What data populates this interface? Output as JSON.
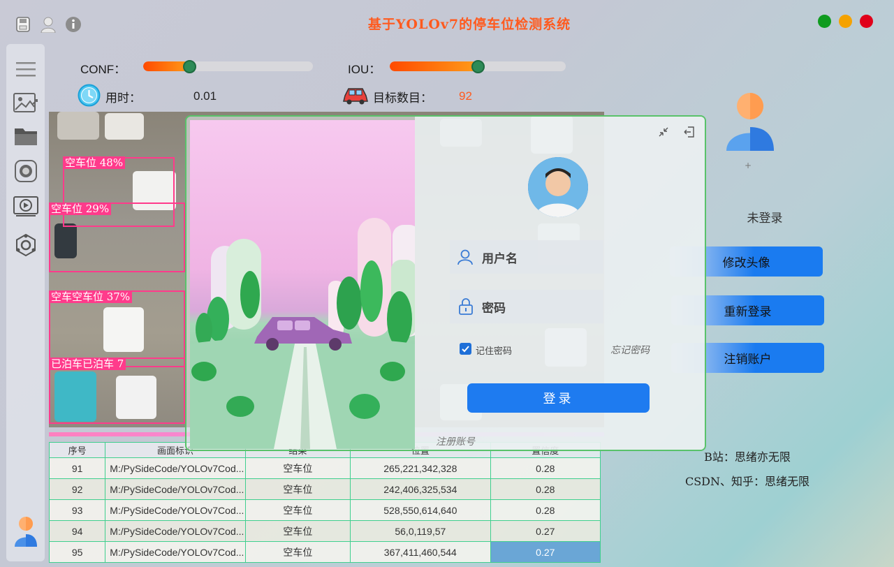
{
  "window": {
    "title": "基于YOLOv7的停车位检测系统",
    "controls": {
      "maximize_color": "#0f9b1f",
      "minimize_color": "#f5a200",
      "close_color": "#e0001a"
    }
  },
  "toolbar_icons": [
    "save-icon",
    "user-icon",
    "info-icon"
  ],
  "sidebar": {
    "items": [
      "menu-icon",
      "image-icon",
      "folder-icon",
      "camera-icon",
      "video-icon",
      "settings-icon"
    ]
  },
  "params": {
    "conf_label": "CONF：",
    "conf_level": 0.27,
    "iou_label": "IOU：",
    "iou_level": 0.5,
    "time_label": "用时：",
    "time_value": "0.01",
    "count_label": "目标数目：",
    "count_value": "92"
  },
  "detections": [
    {
      "label": "空车位 48%"
    },
    {
      "label": "空车位 29%"
    },
    {
      "label": "空车空车位 37%"
    },
    {
      "label": "已泊车已泊车 7"
    }
  ],
  "table": {
    "headers": [
      "序号",
      "画面标识",
      "结果",
      "位置",
      "置信度"
    ],
    "rows": [
      [
        "91",
        "M:/PySideCode/YOLOv7Cod...",
        "空车位",
        "265,221,342,328",
        "0.28"
      ],
      [
        "92",
        "M:/PySideCode/YOLOv7Cod...",
        "空车位",
        "242,406,325,534",
        "0.28"
      ],
      [
        "93",
        "M:/PySideCode/YOLOv7Cod...",
        "空车位",
        "528,550,614,640",
        "0.28"
      ],
      [
        "94",
        "M:/PySideCode/YOLOv7Cod...",
        "空车位",
        "56,0,119,57",
        "0.27"
      ],
      [
        "95",
        "M:/PySideCode/YOLOv7Cod...",
        "空车位",
        "367,411,460,544",
        "0.27"
      ]
    ]
  },
  "user_panel": {
    "status": "未登录",
    "change_avatar": "修改头像",
    "relogin": "重新登录",
    "delete_account": "注销账户",
    "footer_bilibili": "B站：思绪亦无限",
    "footer_csdn": "CSDN、知乎：思绪无限"
  },
  "login_dialog": {
    "username_placeholder": "用户名",
    "password_placeholder": "密码",
    "remember_label": "记住密码",
    "remember_checked": true,
    "forgot_label": "忘记密码",
    "login_button": "登录",
    "register_link": "注册账号"
  },
  "colors": {
    "title": "#ff5a1e",
    "accent_blue": "#1a7bf0",
    "box_pink": "#ff3b8b",
    "table_border": "#3fcf8e",
    "slider_knob": "#2e8b57"
  }
}
